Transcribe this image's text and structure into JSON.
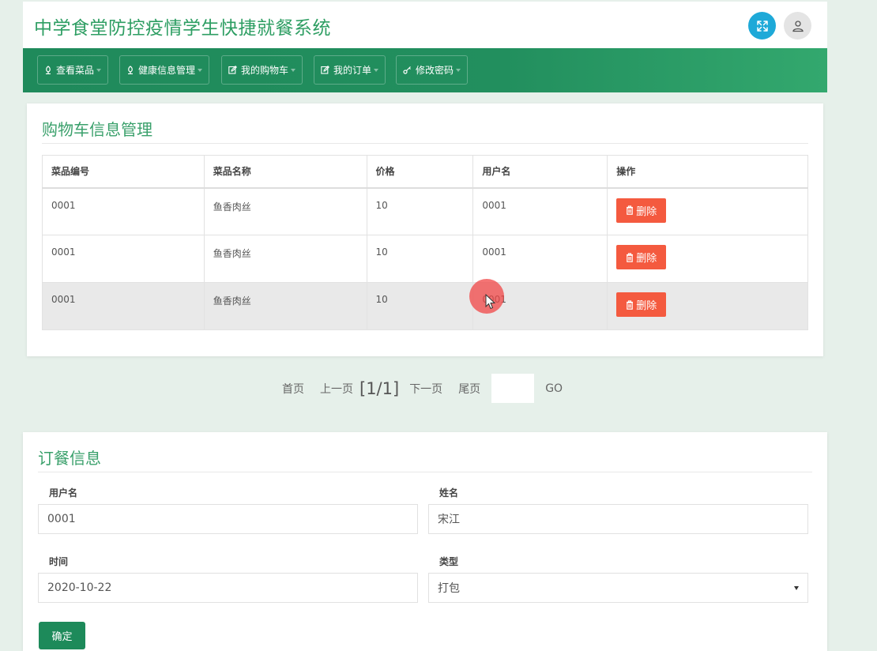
{
  "header": {
    "title": "中学食堂防控疫情学生快捷就餐系统"
  },
  "nav": {
    "items": [
      {
        "label": "查看菜品"
      },
      {
        "label": "健康信息管理"
      },
      {
        "label": "我的购物车"
      },
      {
        "label": "我的订单"
      },
      {
        "label": "修改密码"
      }
    ]
  },
  "cart": {
    "title": "购物车信息管理",
    "columns": [
      "菜品编号",
      "菜品名称",
      "价格",
      "用户名",
      "操作"
    ],
    "rows": [
      {
        "code": "0001",
        "name": "鱼香肉丝",
        "price": "10",
        "user": "0001",
        "action": "删除"
      },
      {
        "code": "0001",
        "name": "鱼香肉丝",
        "price": "10",
        "user": "0001",
        "action": "删除"
      },
      {
        "code": "0001",
        "name": "鱼香肉丝",
        "price": "10",
        "user": "0001",
        "action": "删除"
      }
    ]
  },
  "pager": {
    "first": "首页",
    "prev": "上一页",
    "current": "[1/1]",
    "next": "下一页",
    "last": "尾页",
    "go": "GO"
  },
  "order": {
    "title": "订餐信息",
    "username_label": "用户名",
    "username_value": "0001",
    "name_label": "姓名",
    "name_value": "宋江",
    "time_label": "时间",
    "time_value": "2020-10-22",
    "type_label": "类型",
    "type_value": "打包",
    "submit_label": "确定"
  },
  "colors": {
    "brand": "#2e9e63",
    "nav": "#1f8a5b",
    "danger": "#f45a3f",
    "info": "#1ea9d8"
  }
}
